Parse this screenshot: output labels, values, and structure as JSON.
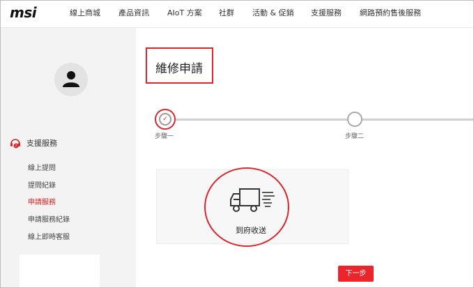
{
  "brand": {
    "logo_text": "msi"
  },
  "nav": {
    "items": [
      "線上商城",
      "產品資訊",
      "AIoT 方案",
      "社群",
      "活動 & 促銷",
      "支援服務",
      "網路預約售後服務"
    ]
  },
  "sidebar": {
    "section_title": "支援服務",
    "links": [
      "線上提問",
      "提問紀錄",
      "申請服務",
      "申請服務紀錄",
      "線上即時客服"
    ],
    "active_index": 2
  },
  "main": {
    "title": "維修申請",
    "steps": [
      "步驟一",
      "步驟二"
    ],
    "current_step": 1,
    "option_label": "到府收送",
    "next_button": "下一步"
  },
  "colors": {
    "accent": "#d9262c",
    "sidebar_bg": "#f3f3f3",
    "button_bg": "#e8262c"
  },
  "icons": {
    "avatar": "user-silhouette-icon",
    "support": "headset-icon",
    "option": "delivery-truck-icon",
    "step_done": "check-icon"
  }
}
